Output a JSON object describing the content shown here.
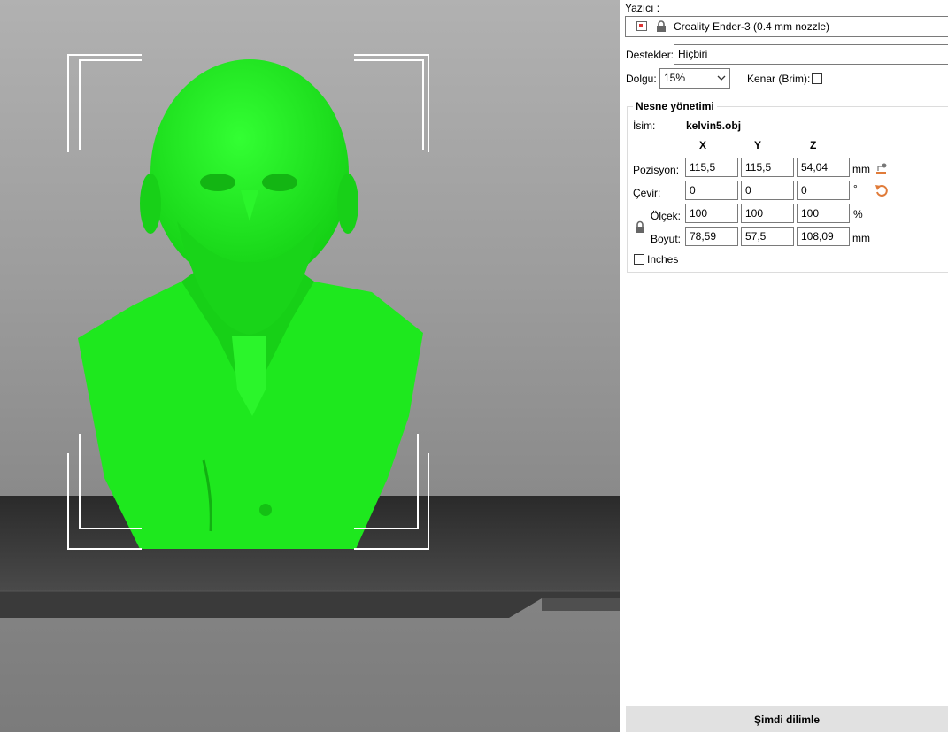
{
  "printer": {
    "label": "Yazıcı :",
    "value": "Creality Ender-3 (0.4 mm nozzle)",
    "icons": [
      "printer-icon",
      "lock-icon"
    ]
  },
  "supports": {
    "label": "Destekler:",
    "value": "Hiçbiri"
  },
  "infill": {
    "label": "Dolgu:",
    "value": "15%"
  },
  "brim": {
    "label": "Kenar (Brim):",
    "checked": false
  },
  "object_manager": {
    "title": "Nesne yönetimi",
    "name_label": "İsim:",
    "name_value": "kelvin5.obj",
    "columns": [
      "X",
      "Y",
      "Z"
    ],
    "position": {
      "label": "Pozisyon:",
      "x": "115,5",
      "y": "115,5",
      "z": "54,04",
      "unit": "mm"
    },
    "rotation": {
      "label": "Çevir:",
      "x": "0",
      "y": "0",
      "z": "0",
      "unit": "°"
    },
    "scale": {
      "label": "Ölçek:",
      "x": "100",
      "y": "100",
      "z": "100",
      "unit": "%"
    },
    "size": {
      "label": "Boyut:",
      "x": "78,59",
      "y": "57,5",
      "z": "108,09",
      "unit": "mm"
    },
    "inches": {
      "label": "Inches",
      "checked": false
    }
  },
  "slice_button": {
    "label": "Şimdi dilimle"
  },
  "colors": {
    "model_green": "#1ee81e",
    "accent_orange": "#e07b39",
    "bed_dark": "#3c3c3c"
  }
}
